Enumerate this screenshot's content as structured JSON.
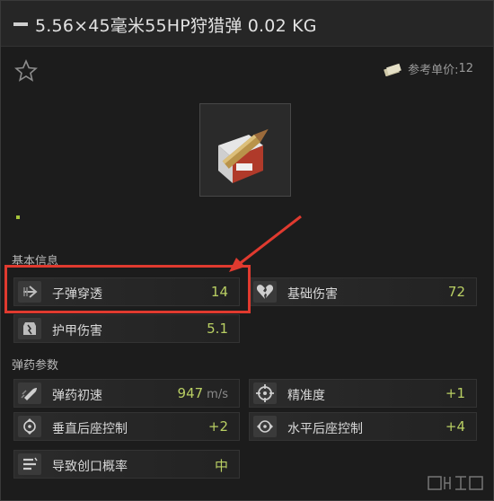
{
  "header": {
    "title": "5.56×45毫米55HP狩猎弹 0.02 KG"
  },
  "price": {
    "label": "参考单价:",
    "value": "12"
  },
  "sections": {
    "basic_info": "基本信息",
    "ammo_params": "弹药参数"
  },
  "stats": {
    "penetration": {
      "label": "子弹穿透",
      "value": "14",
      "icon": "penetration-icon"
    },
    "damage": {
      "label": "基础伤害",
      "value": "72",
      "icon": "broken-heart-icon"
    },
    "armor_damage": {
      "label": "护甲伤害",
      "value": "5.1",
      "icon": "armor-damage-icon"
    },
    "muzzle_velocity": {
      "label": "弹药初速",
      "value": "947",
      "unit": "m/s",
      "icon": "bullet-speed-icon"
    },
    "accuracy": {
      "label": "精准度",
      "value": "+1",
      "icon": "crosshair-icon"
    },
    "vertical_recoil": {
      "label": "垂直后座控制",
      "value": "+2",
      "icon": "vertical-recoil-icon"
    },
    "horizontal_recoil": {
      "label": "水平后座控制",
      "value": "+4",
      "icon": "horizontal-recoil-icon"
    },
    "bleed_chance": {
      "label": "导致创口概率",
      "value": "中",
      "icon": "bleed-icon"
    }
  },
  "colors": {
    "accent_value": "#b9cf63",
    "highlight": "#e03a2f"
  }
}
